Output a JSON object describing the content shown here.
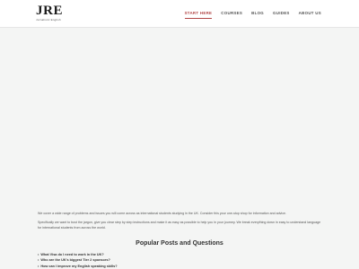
{
  "header": {
    "logo": {
      "mark": "JRE",
      "tagline": "Jurnalistic English"
    },
    "nav": [
      {
        "label": "START HERE",
        "active": true
      },
      {
        "label": "COURSES",
        "active": false
      },
      {
        "label": "BLOG",
        "active": false
      },
      {
        "label": "GUIDES",
        "active": false
      },
      {
        "label": "ABOUT US",
        "active": false
      }
    ]
  },
  "intro": {
    "paragraph_1": "We cover a wide range of problems and issues you will come across as international students studying in the UK. Consider this your one-stop shop for information and advice.",
    "paragraph_2": "Specifically we want to bust the jargon, give you clear step by step instructions and make it as easy as possible to help you in your journey. We break everything down in easy to understand language for international students from across the world."
  },
  "popular": {
    "title": "Popular Posts and Questions",
    "items": [
      "What Visa do I need to work in the UK?",
      "Who are the UK's biggest Tier 2 sponsors?",
      "How can I improve my English speaking skills?"
    ]
  },
  "colors": {
    "accent": "#b24646",
    "background": "#f4f5f4",
    "header_bg": "#ffffff"
  }
}
